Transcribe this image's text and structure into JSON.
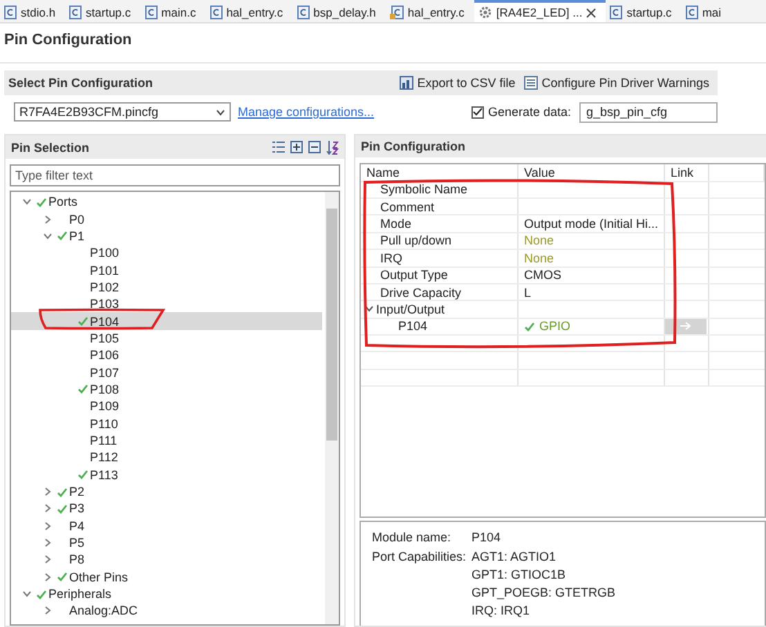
{
  "tabs": [
    {
      "label": "stdio.h",
      "kind": "source",
      "selected": false
    },
    {
      "label": "startup.c",
      "kind": "source",
      "selected": false
    },
    {
      "label": "main.c",
      "kind": "source",
      "selected": false
    },
    {
      "label": "hal_entry.c",
      "kind": "source",
      "selected": false
    },
    {
      "label": "bsp_delay.h",
      "kind": "source",
      "selected": false
    },
    {
      "label": "hal_entry.c",
      "kind": "locked",
      "selected": false
    },
    {
      "label": "[RA4E2_LED] ...",
      "kind": "config",
      "selected": true
    },
    {
      "label": "startup.c",
      "kind": "source",
      "selected": false
    },
    {
      "label": "mai",
      "kind": "source",
      "selected": false
    }
  ],
  "page_title": "Pin Configuration",
  "select_section": {
    "title": "Select Pin Configuration",
    "export_button": "Export to CSV file",
    "warnings_button": "Configure Pin Driver Warnings",
    "config_file": "R7FA4E2B93CFM.pincfg",
    "manage_link": "Manage configurations...",
    "generate_data": {
      "label": "Generate data:",
      "checked": true,
      "value": "g_bsp_pin_cfg"
    }
  },
  "pin_selection": {
    "title": "Pin Selection",
    "filter": {
      "placeholder": "Type filter text"
    },
    "tree": [
      {
        "label": "Ports",
        "checked": true,
        "expanded": true,
        "selected": false,
        "children": [
          {
            "label": "P0",
            "checked": false,
            "expanded": false,
            "selected": false
          },
          {
            "label": "P1",
            "checked": true,
            "expanded": true,
            "selected": false,
            "children": [
              {
                "label": "P100",
                "checked": false,
                "selected": false
              },
              {
                "label": "P101",
                "checked": false,
                "selected": false
              },
              {
                "label": "P102",
                "checked": false,
                "selected": false
              },
              {
                "label": "P103",
                "checked": false,
                "selected": false
              },
              {
                "label": "P104",
                "checked": true,
                "selected": true
              },
              {
                "label": "P105",
                "checked": false,
                "selected": false
              },
              {
                "label": "P106",
                "checked": false,
                "selected": false
              },
              {
                "label": "P107",
                "checked": false,
                "selected": false
              },
              {
                "label": "P108",
                "checked": true,
                "selected": false
              },
              {
                "label": "P109",
                "checked": false,
                "selected": false
              },
              {
                "label": "P110",
                "checked": false,
                "selected": false
              },
              {
                "label": "P111",
                "checked": false,
                "selected": false
              },
              {
                "label": "P112",
                "checked": false,
                "selected": false
              },
              {
                "label": "P113",
                "checked": true,
                "selected": false
              }
            ]
          },
          {
            "label": "P2",
            "checked": true,
            "expanded": false,
            "selected": false
          },
          {
            "label": "P3",
            "checked": true,
            "expanded": false,
            "selected": false
          },
          {
            "label": "P4",
            "checked": false,
            "expanded": false,
            "selected": false
          },
          {
            "label": "P5",
            "checked": false,
            "expanded": false,
            "selected": false
          },
          {
            "label": "P8",
            "checked": false,
            "expanded": false,
            "selected": false
          },
          {
            "label": "Other Pins",
            "checked": true,
            "expanded": false,
            "selected": false
          }
        ]
      },
      {
        "label": "Peripherals",
        "checked": true,
        "expanded": true,
        "selected": false,
        "children": [
          {
            "label": "Analog:ADC",
            "checked": false,
            "expanded": false,
            "selected": false
          }
        ]
      }
    ]
  },
  "pin_configuration": {
    "title": "Pin Configuration",
    "columns": [
      "Name",
      "Value",
      "Link"
    ],
    "rows": [
      {
        "kind": "text",
        "name": "Symbolic Name"
      },
      {
        "kind": "text",
        "name": "Comment"
      },
      {
        "kind": "text",
        "name": "Mode",
        "value": "Output mode (Initial Hi..."
      },
      {
        "kind": "warning",
        "name": "Pull up/down",
        "value": "None"
      },
      {
        "kind": "warning",
        "name": "IRQ",
        "value": "None"
      },
      {
        "kind": "text",
        "name": "Output Type",
        "value": "CMOS"
      },
      {
        "kind": "text",
        "name": "Drive Capacity",
        "value": "L"
      },
      {
        "kind": "group",
        "name": "Input/Output",
        "expanded": true
      },
      {
        "kind": "pin",
        "name": "P104",
        "value": "GPIO",
        "checked": true
      }
    ],
    "details": [
      {
        "label": "Module name:",
        "values": [
          "P104"
        ]
      },
      {
        "label": "Port Capabilities:",
        "values": [
          "AGT1: AGTIO1",
          "GPT1: GTIOC1B",
          "GPT_POEGB: GTETRGB",
          "IRQ: IRQ1"
        ]
      }
    ]
  }
}
